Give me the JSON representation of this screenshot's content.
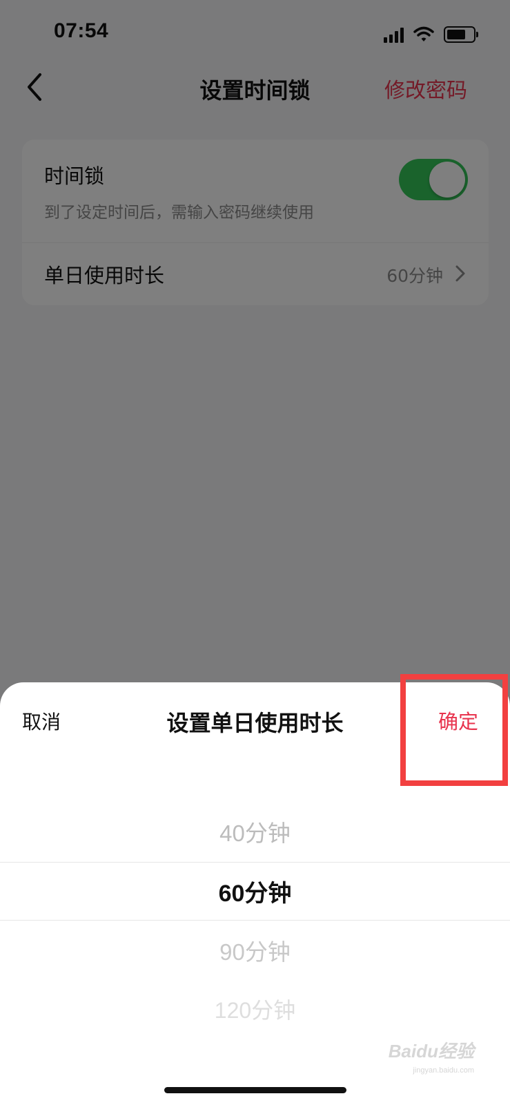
{
  "status_bar": {
    "time": "07:54",
    "icons": [
      "signal-icon",
      "wifi-icon",
      "battery-icon"
    ]
  },
  "nav": {
    "title": "设置时间锁",
    "action_label": "修改密码",
    "back_icon": "chevron-left-icon"
  },
  "settings_card": {
    "time_lock_title": "时间锁",
    "time_lock_desc": "到了设定时间后，需输入密码继续使用",
    "time_lock_enabled": true,
    "duration_label": "单日使用时长",
    "duration_value": "60分钟"
  },
  "sheet": {
    "cancel_label": "取消",
    "title": "设置单日使用时长",
    "confirm_label": "确定",
    "picker_options": [
      "40分钟",
      "60分钟",
      "90分钟",
      "120分钟"
    ],
    "selected_option": "60分钟"
  },
  "watermark": {
    "brand": "Baidu经验",
    "url": "jingyan.baidu.com"
  },
  "colors": {
    "accent": "#e8344e",
    "toggle_on": "#34c759",
    "highlight": "#f24040"
  }
}
